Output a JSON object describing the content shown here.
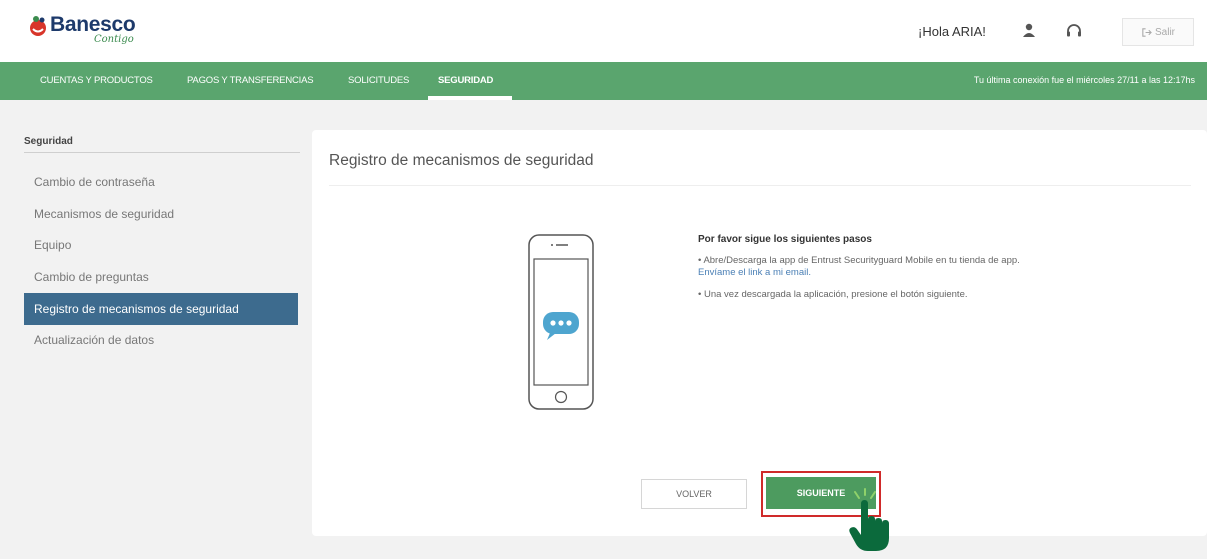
{
  "header": {
    "logo_text": "Banesco",
    "logo_sub": "Contigo",
    "greeting": "¡Hola ARIA!",
    "user_icon": "user-icon",
    "support_icon": "headset-icon",
    "logout_label": "Salir",
    "logout_icon": "logout-icon"
  },
  "nav": {
    "items": [
      {
        "label": "CUENTAS Y PRODUCTOS"
      },
      {
        "label": "PAGOS Y TRANSFERENCIAS"
      },
      {
        "label": "SOLICITUDES"
      },
      {
        "label": "SEGURIDAD"
      }
    ],
    "active_index": 3,
    "last_connection": "Tu última conexión fue el miércoles 27/11 a las 12:17hs"
  },
  "sidebar": {
    "title": "Seguridad",
    "items": [
      {
        "label": "Cambio de contraseña"
      },
      {
        "label": "Mecanismos de seguridad"
      },
      {
        "label": "Equipo"
      },
      {
        "label": "Cambio de preguntas"
      },
      {
        "label": "Registro de mecanismos de seguridad"
      },
      {
        "label": "Actualización de datos"
      }
    ],
    "active_index": 4
  },
  "main": {
    "title": "Registro de mecanismos de seguridad",
    "steps_title": "Por favor sigue los siguientes pasos",
    "step1": "• Abre/Descarga la app de Entrust Securityguard Mobile en tu tienda de app.",
    "step1_link": "Envíame el link a mi email.",
    "step2": "• Una vez descargada la aplicación, presione el botón siguiente.",
    "back_label": "VOLVER",
    "next_label": "SIGUIENTE"
  },
  "colors": {
    "nav_green": "#5aa56e",
    "sidebar_active": "#3d6b8e",
    "next_button": "#4d9b5f",
    "highlight_red": "#d02a2a",
    "brand_blue": "#1d3a6b"
  }
}
